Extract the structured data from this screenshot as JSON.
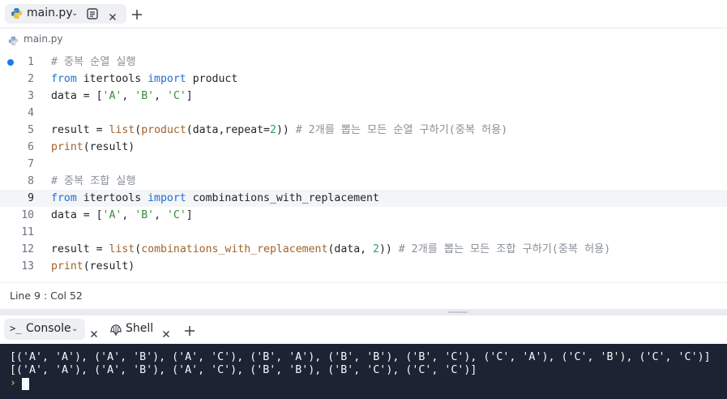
{
  "file_tab": {
    "label": "main.py"
  },
  "breadcrumb": {
    "label": "main.py"
  },
  "editor": {
    "lines": [
      {
        "n": "1",
        "code": [
          {
            "t": "# 중복 순열 실행",
            "c": "cm"
          }
        ]
      },
      {
        "n": "2",
        "code": [
          {
            "t": "from",
            "c": "kw"
          },
          {
            "t": " itertools "
          },
          {
            "t": "import",
            "c": "kw"
          },
          {
            "t": " product"
          }
        ]
      },
      {
        "n": "3",
        "code": [
          {
            "t": "data = ["
          },
          {
            "t": "'A'",
            "c": "str"
          },
          {
            "t": ", "
          },
          {
            "t": "'B'",
            "c": "str"
          },
          {
            "t": ", "
          },
          {
            "t": "'C'",
            "c": "str"
          },
          {
            "t": "]"
          }
        ]
      },
      {
        "n": "4",
        "code": []
      },
      {
        "n": "5",
        "code": [
          {
            "t": "result = "
          },
          {
            "t": "list",
            "c": "fn"
          },
          {
            "t": "("
          },
          {
            "t": "product",
            "c": "fn"
          },
          {
            "t": "(data,repeat="
          },
          {
            "t": "2",
            "c": "num"
          },
          {
            "t": ")) "
          },
          {
            "t": "# 2개를 뽑는 모든 순열 구하기(중복 허용)",
            "c": "cm"
          }
        ]
      },
      {
        "n": "6",
        "code": [
          {
            "t": "print",
            "c": "fn"
          },
          {
            "t": "(result)"
          }
        ]
      },
      {
        "n": "7",
        "code": []
      },
      {
        "n": "8",
        "code": [
          {
            "t": "# 중복 조합 실행",
            "c": "cm"
          }
        ]
      },
      {
        "n": "9",
        "code": [
          {
            "t": "from",
            "c": "kw"
          },
          {
            "t": " itertools "
          },
          {
            "t": "import",
            "c": "kw"
          },
          {
            "t": " combinations_with_replacement"
          }
        ]
      },
      {
        "n": "10",
        "code": [
          {
            "t": "data = ["
          },
          {
            "t": "'A'",
            "c": "str"
          },
          {
            "t": ", "
          },
          {
            "t": "'B'",
            "c": "str"
          },
          {
            "t": ", "
          },
          {
            "t": "'C'",
            "c": "str"
          },
          {
            "t": "]"
          }
        ]
      },
      {
        "n": "11",
        "code": []
      },
      {
        "n": "12",
        "code": [
          {
            "t": "result = "
          },
          {
            "t": "list",
            "c": "fn"
          },
          {
            "t": "("
          },
          {
            "t": "combinations_with_replacement",
            "c": "fn"
          },
          {
            "t": "(data, "
          },
          {
            "t": "2",
            "c": "num"
          },
          {
            "t": ")) "
          },
          {
            "t": "# 2개를 뽑는 모든 조합 구하기(중복 허용)",
            "c": "cm"
          }
        ]
      },
      {
        "n": "13",
        "code": [
          {
            "t": "print",
            "c": "fn"
          },
          {
            "t": "(result)"
          }
        ]
      }
    ],
    "active_line": "9",
    "modified_line": "1"
  },
  "status": {
    "position": "Line 9 : Col 52"
  },
  "console_tabs": {
    "console_label": "Console",
    "shell_label": "Shell"
  },
  "terminal": {
    "output": [
      "[('A', 'A'), ('A', 'B'), ('A', 'C'), ('B', 'A'), ('B', 'B'), ('B', 'C'), ('C', 'A'), ('C', 'B'), ('C', 'C')]",
      "[('A', 'A'), ('A', 'B'), ('A', 'C'), ('B', 'B'), ('B', 'C'), ('C', 'C')]"
    ],
    "prompt": "›"
  },
  "colors": {
    "accent": "#1a7cf0",
    "terminal_bg": "#1c2333",
    "prompt": "#f0c24b"
  }
}
